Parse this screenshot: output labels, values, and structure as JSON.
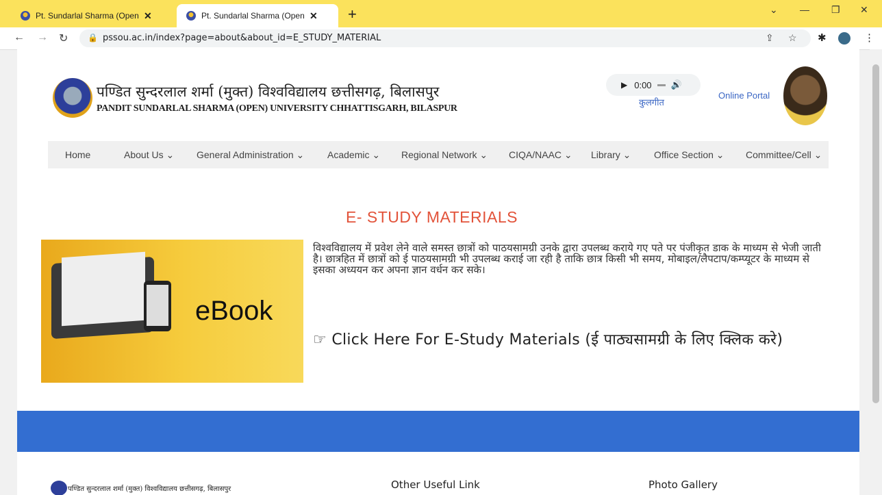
{
  "browser": {
    "tabs": [
      {
        "title": "Pt. Sundarlal Sharma (Open) Univ"
      },
      {
        "title": "Pt. Sundarlal Sharma (Open) Univ"
      }
    ],
    "url": "pssou.ac.in/index?page=about&about_id=E_STUDY_MATERIAL"
  },
  "header": {
    "name_hindi": "पण्डित सुन्दरलाल शर्मा (मुक्त) विश्वविद्यालय छत्तीसगढ़, बिलासपुर",
    "name_english": "PANDIT SUNDARLAL SHARMA (OPEN) UNIVERSITY CHHATTISGARH, BILASPUR",
    "audio_time": "0:00",
    "kulgeet": "कुलगीत",
    "online_portal": "Online Portal"
  },
  "nav": [
    {
      "label": "Home"
    },
    {
      "label": "About Us ⌄"
    },
    {
      "label": "General Administration ⌄"
    },
    {
      "label": "Academic ⌄"
    },
    {
      "label": "Regional Network ⌄"
    },
    {
      "label": "CIQA/NAAC ⌄"
    },
    {
      "label": "Library ⌄"
    },
    {
      "label": "Office Section ⌄"
    },
    {
      "label": "Committee/Cell ⌄"
    }
  ],
  "main": {
    "heading": "E- STUDY MATERIALS",
    "ebook_label": "eBook",
    "paragraph": "विश्वविद्यालय में प्रवेश लेने वाले समस्त छात्रों को पाठयसामग्री उनके द्वारा उपलब्ध कराये गए पते पर पंजीकृत डाक के माध्यम से भेजी जाती है। छात्रहित में छात्रों को ई पाठयसामग्री भी उपलब्ध कराई जा रही है ताकि छात्र किसी भी समय, मोबाइल/लैपटाप/कम्प्यूटर के माध्यम से इसका अध्ययन कर अपना ज्ञान वर्धन कर सके।",
    "click_link": "☞ Click Here For E-Study Materials (ई पाठ्यसामग्री के लिए क्लिक करे)"
  },
  "footer": {
    "logo_text": "पण्डित सुन्दरलाल शर्मा (मुक्त) विश्वविद्यालय छत्तीसगढ़, बिलासपुर",
    "other_links": "Other Useful Link",
    "photo_gallery": "Photo Gallery"
  }
}
